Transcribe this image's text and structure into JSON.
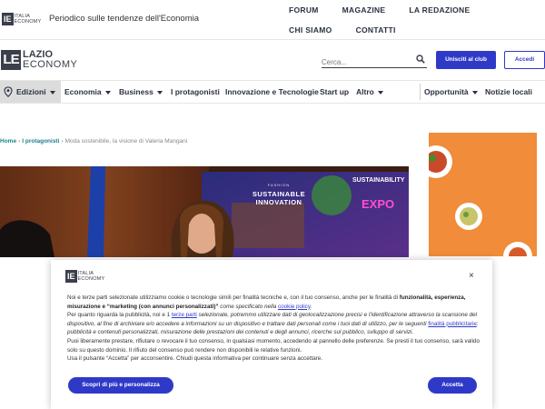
{
  "header": {
    "mini_logo_mark": "IE",
    "mini_logo_l1": "Italia",
    "mini_logo_l2": "Economy",
    "tagline": "Periodico sulle tendenze dell'Economia",
    "topnav": [
      "FORUM",
      "MAGAZINE",
      "LA REDAZIONE",
      "CHI SIAMO",
      "CONTATTI"
    ]
  },
  "brand": {
    "logo_mark": "LE",
    "logo_line1": "LAZIO",
    "logo_line2": "ECONOMY",
    "search_placeholder": "Cerca...",
    "club_button": "Unisciti al club",
    "login_button": "Accedi"
  },
  "mainnav": {
    "items": [
      "Edizioni",
      "Economia",
      "Business",
      "I protagonisti",
      "Innovazione e Tecnologie",
      "Start up",
      "Altro",
      "Opportunità",
      "Notizie locali"
    ]
  },
  "breadcrumb": {
    "home": "Home",
    "section": "I protagonisti",
    "current": "Moda sostenibile, la visione di Valeria Mangani"
  },
  "hero": {
    "banner_l1": "SUSTAINABLE",
    "banner_l2": "INNOVATION",
    "banner_top": "FASHION",
    "right_text": "SUSTAINABILITY",
    "expo": "EXPO"
  },
  "cookie": {
    "logo_mark": "IE",
    "logo_l1": "Italia",
    "logo_l2": "Economy",
    "close": "×",
    "p1_a": "Noi e terze parti selezionate utilizziamo cookie o tecnologie simili per finalità tecniche e, con il tuo consenso, anche per le finalità di ",
    "p1_b": "funzionalità, esperienza, misurazione e “marketing (con annunci personalizzati)”",
    "p1_c": " come specificato nella ",
    "p1_link": "cookie policy",
    "p1_d": ".",
    "p2_a": "Per quanto riguarda la pubblicità, noi e 1 ",
    "p2_link1": "terze parti",
    "p2_b": " selezionate, potremmo utilizzare dati di geolocalizzazione precisi e l'identificazione attraverso la scansione del dispositivo, al fine di archiviare e/o accedere a informazioni su un dispositivo e trattare dati personali come i tuoi dati di utilizzo, per le seguenti ",
    "p2_link2": "finalità pubblicitarie",
    "p2_c": ": pubblicità e contenuti personalizzati, misurazione delle prestazioni dei contenuti e degli annunci, ricerche sul pubblico, sviluppo di servizi.",
    "p3": "Puoi liberamente prestare, rifiutare o revocare il tuo consenso, in qualsiasi momento, accedendo al pannello delle preferenze. Se presti il tuo consenso, sarà valido solo su questo dominio. Il rifiuto del consenso può rendere non disponibili le relative funzioni.",
    "p4": "Usa il pulsante “Accetta” per acconsentire. Chiudi questa informativa per continuare senza accettare.",
    "more_button": "Scopri di più e personalizza",
    "accept_button": "Accetta"
  },
  "colors": {
    "accent": "#2f39c8",
    "logo_dark": "#3a3f4b",
    "link_teal": "#1c7f8a",
    "ad_orange": "#f08c3a"
  }
}
